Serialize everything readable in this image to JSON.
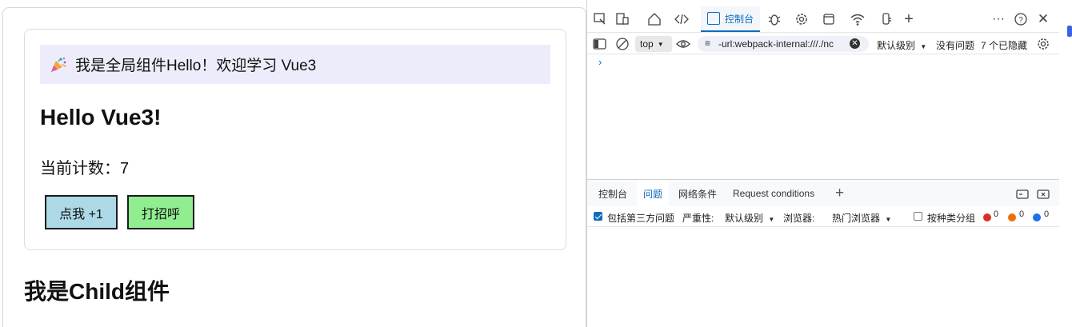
{
  "page": {
    "banner_text": "我是全局组件Hello！欢迎学习 Vue3",
    "hello_title": "Hello Vue3!",
    "count_label": "当前计数：",
    "count_value": "7",
    "buttons": {
      "increment": "点我 +1",
      "greet": "打招呼"
    },
    "child_title": "我是Child组件"
  },
  "colors": {
    "banner_bg": "#ececfb",
    "increment_btn": "#add8e6",
    "greet_btn": "#90ee90",
    "devtools_accent": "#0f6cbd"
  },
  "devtools": {
    "top_tabs": {
      "console_label": "控制台",
      "icons": [
        "inspect-icon",
        "device-emulation-icon",
        "welcome-home-icon",
        "elements-code-icon",
        "console-icon",
        "sources-bug-icon",
        "performance-gear-icon",
        "application-window-icon",
        "network-wifi-icon",
        "memory-icon",
        "more-tools-plus-icon",
        "more-options-icon",
        "help-icon",
        "close-icon"
      ]
    },
    "console_toolbar": {
      "context": "top",
      "filter_value": "-url:webpack-internal:///./nc",
      "level": "默认级别",
      "issues": "没有问题",
      "hidden": "7 个已隐藏"
    },
    "prompt_symbol": "›",
    "drawer_tabs": [
      "控制台",
      "问题",
      "网络条件",
      "Request conditions"
    ],
    "active_drawer_tab": "问题",
    "issues_toolbar": {
      "third_party_label": "包括第三方问题",
      "severity_label": "严重性:",
      "severity_value": "默认级别",
      "browser_label": "浏览器:",
      "browser_value": "热门浏览器",
      "group_label": "按种类分组",
      "counts": {
        "errors": "0",
        "warnings": "0",
        "info": "0"
      }
    }
  }
}
